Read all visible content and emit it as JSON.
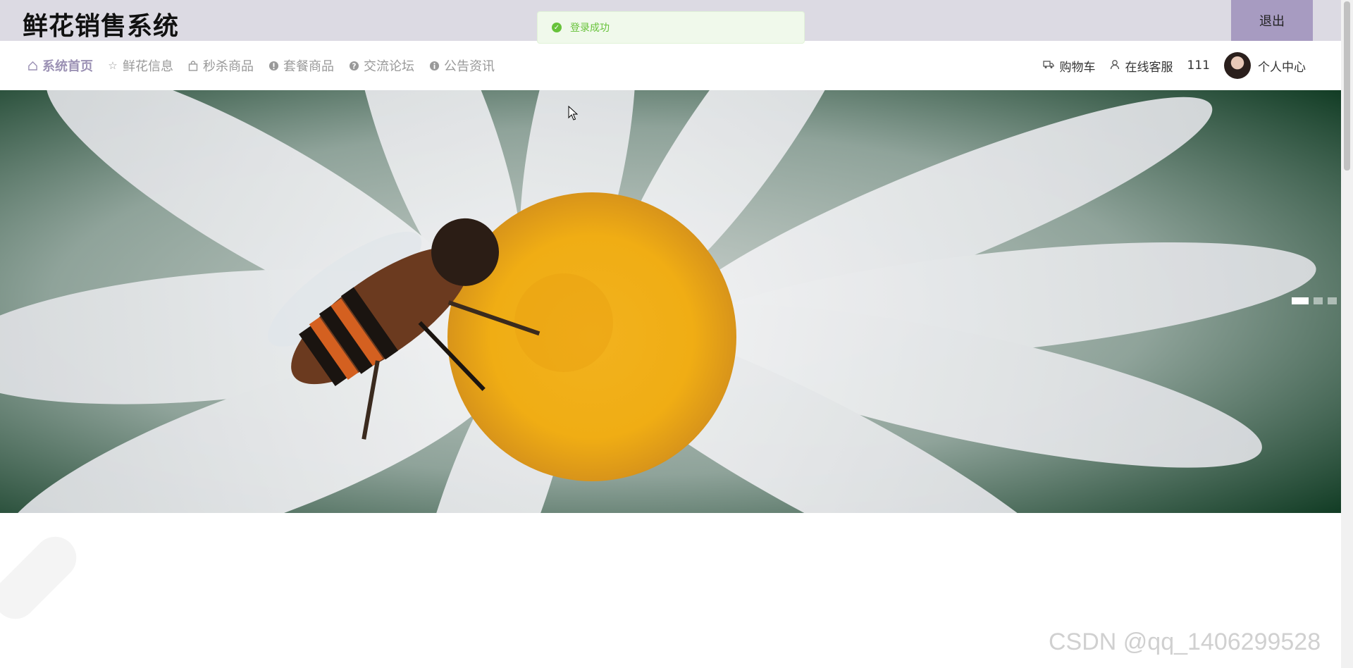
{
  "header": {
    "site_title": "鲜花销售系统",
    "logout_label": "退出"
  },
  "toast": {
    "message": "登录成功",
    "type": "success"
  },
  "nav": {
    "items": [
      {
        "label": "系统首页",
        "icon": "home-icon",
        "active": true
      },
      {
        "label": "鲜花信息",
        "icon": "star-icon",
        "active": false
      },
      {
        "label": "秒杀商品",
        "icon": "bag-icon",
        "active": false
      },
      {
        "label": "套餐商品",
        "icon": "info-circle-icon",
        "active": false
      },
      {
        "label": "交流论坛",
        "icon": "question-circle-icon",
        "active": false
      },
      {
        "label": "公告资讯",
        "icon": "info-circle-icon",
        "active": false
      }
    ],
    "right": {
      "cart_label": "购物车",
      "service_label": "在线客服",
      "username": "111",
      "profile_label": "个人中心"
    }
  },
  "banner": {
    "slide_count": 3,
    "active_slide": 1
  },
  "watermark": "CSDN @qq_1406299528",
  "colors": {
    "topbar_bg": "#dcdae3",
    "accent": "#a79bc1",
    "active_nav": "#9b91b4",
    "toast_success": "#67c23a"
  }
}
